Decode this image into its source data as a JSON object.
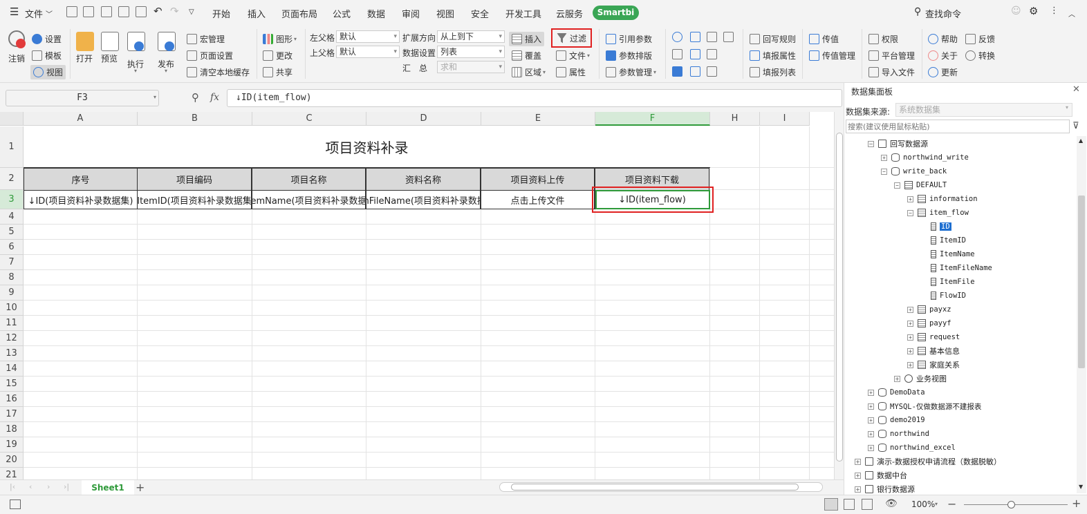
{
  "menu": {
    "file_label": "文件",
    "tabs": [
      "开始",
      "插入",
      "页面布局",
      "公式",
      "数据",
      "审阅",
      "视图",
      "安全",
      "开发工具",
      "云服务"
    ],
    "smartbi_label": "Smartbi",
    "search_label": "查找命令"
  },
  "ribbon": {
    "logout": "注销",
    "settings": "设置",
    "template": "模板",
    "view": "视图",
    "open": "打开",
    "preview": "预览",
    "execute": "执行",
    "publish": "发布",
    "macro": "宏管理",
    "page_setup": "页面设置",
    "clear_cache": "清空本地缓存",
    "shape": "图形",
    "modify": "更改",
    "share": "共享",
    "left_parent_label": "左父格",
    "left_parent_value": "默认",
    "top_parent_label": "上父格",
    "top_parent_value": "默认",
    "expand_dir_label": "扩展方向",
    "expand_dir_value": "从上到下",
    "data_setting_label": "数据设置",
    "data_setting_value": "列表",
    "summary_label": "汇　总",
    "summary_value": "求和",
    "insert": "插入",
    "cover": "覆盖",
    "region": "区域",
    "filter": "过滤",
    "file": "文件",
    "attribute": "属性",
    "ref_param": "引用参数",
    "param_layout": "参数排版",
    "param_manage": "参数管理",
    "writeback_rule": "回写规则",
    "fill_attr": "填报属性",
    "fill_list": "填报列表",
    "pass_value": "传值",
    "pass_manage": "传值管理",
    "permission": "权限",
    "platform_manage": "平台管理",
    "import_file": "导入文件",
    "help": "帮助",
    "about": "关于",
    "update": "更新",
    "feedback": "反馈",
    "convert": "转换"
  },
  "formula": {
    "cell_ref": "F3",
    "fx": "fx",
    "content": "↓ID(item_flow)"
  },
  "sheet": {
    "columns": [
      "A",
      "B",
      "C",
      "D",
      "E",
      "F",
      "H",
      "I"
    ],
    "rows": [
      "1",
      "2",
      "3",
      "4",
      "5",
      "6",
      "7",
      "8",
      "9",
      "10",
      "11",
      "12",
      "13",
      "14",
      "15",
      "16",
      "17",
      "18",
      "19",
      "20",
      "21"
    ],
    "title": "项目资料补录",
    "headers": [
      "序号",
      "项目编码",
      "项目名称",
      "资料名称",
      "项目资料上传",
      "项目资料下载"
    ],
    "row3": [
      "↓ID(项目资料补录数据集)",
      "ItemID(项目资料补录数据集",
      "emName(项目资料补录数据",
      "mFileName(项目资料补录数据",
      "点击上传文件",
      "↓ID(item_flow)"
    ]
  },
  "tabs": {
    "sheet1": "Sheet1",
    "add": "+"
  },
  "status": {
    "zoom": "100%"
  },
  "panel": {
    "title": "数据集面板",
    "source_label": "数据集来源:",
    "source_value": "系统数据集",
    "search_placeholder": "搜索(建议使用鼠标粘贴)",
    "tree": [
      {
        "label": "回写数据源",
        "depth": 2,
        "icon": "folder",
        "toggle": "−",
        "mono": false
      },
      {
        "label": "northwind_write",
        "depth": 3,
        "icon": "db",
        "toggle": "+",
        "mono": true
      },
      {
        "label": "write_back",
        "depth": 3,
        "icon": "db",
        "toggle": "−",
        "mono": true
      },
      {
        "label": "DEFAULT",
        "depth": 4,
        "icon": "schema",
        "toggle": "−",
        "mono": true
      },
      {
        "label": "information",
        "depth": 5,
        "icon": "table",
        "toggle": "+",
        "mono": true
      },
      {
        "label": "item_flow",
        "depth": 5,
        "icon": "table",
        "toggle": "−",
        "mono": true
      },
      {
        "label": "ID",
        "depth": 6,
        "icon": "field",
        "toggle": "",
        "mono": true,
        "selected": true
      },
      {
        "label": "ItemID",
        "depth": 6,
        "icon": "field",
        "toggle": "",
        "mono": true
      },
      {
        "label": "ItemName",
        "depth": 6,
        "icon": "field",
        "toggle": "",
        "mono": true
      },
      {
        "label": "ItemFileName",
        "depth": 6,
        "icon": "field",
        "toggle": "",
        "mono": true
      },
      {
        "label": "ItemFile",
        "depth": 6,
        "icon": "field",
        "toggle": "",
        "mono": true
      },
      {
        "label": "FlowID",
        "depth": 6,
        "icon": "field",
        "toggle": "",
        "mono": true
      },
      {
        "label": "payxz",
        "depth": 5,
        "icon": "table",
        "toggle": "+",
        "mono": true
      },
      {
        "label": "payyf",
        "depth": 5,
        "icon": "table",
        "toggle": "+",
        "mono": true
      },
      {
        "label": "request",
        "depth": 5,
        "icon": "table",
        "toggle": "+",
        "mono": true
      },
      {
        "label": "基本信息",
        "depth": 5,
        "icon": "table",
        "toggle": "+",
        "mono": false
      },
      {
        "label": "家庭关系",
        "depth": 5,
        "icon": "table",
        "toggle": "+",
        "mono": false
      },
      {
        "label": "业务视图",
        "depth": 4,
        "icon": "search",
        "toggle": "+",
        "mono": false
      },
      {
        "label": "DemoData",
        "depth": 2,
        "icon": "db",
        "toggle": "+",
        "mono": true
      },
      {
        "label": "MYSQL-仅做数据源不建报表",
        "depth": 2,
        "icon": "db",
        "toggle": "+",
        "mono": true
      },
      {
        "label": "demo2019",
        "depth": 2,
        "icon": "db",
        "toggle": "+",
        "mono": true
      },
      {
        "label": "northwind",
        "depth": 2,
        "icon": "db",
        "toggle": "+",
        "mono": true
      },
      {
        "label": "northwind_excel",
        "depth": 2,
        "icon": "db",
        "toggle": "+",
        "mono": true
      },
      {
        "label": "演示-数据授权申请流程（数据脱敏）",
        "depth": 1,
        "icon": "folder",
        "toggle": "+",
        "mono": false
      },
      {
        "label": "数据中台",
        "depth": 1,
        "icon": "folder",
        "toggle": "+",
        "mono": false
      },
      {
        "label": "银行数据源",
        "depth": 1,
        "icon": "folder",
        "toggle": "+",
        "mono": false
      }
    ]
  },
  "colors": {
    "accent_green": "#3aa655",
    "highlight_red": "#e02020",
    "selection_blue": "#1e6fd0"
  }
}
